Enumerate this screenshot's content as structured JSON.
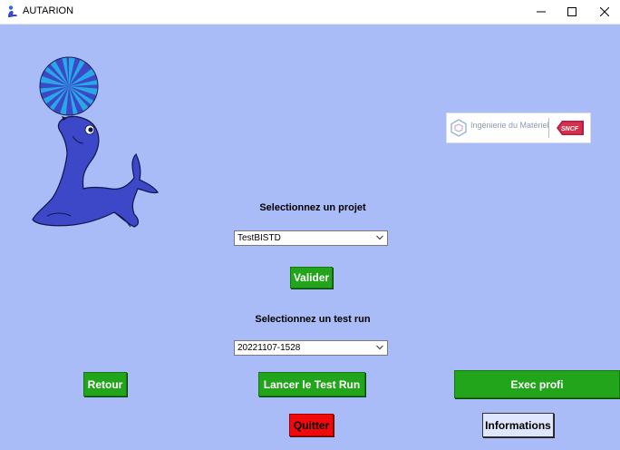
{
  "window": {
    "title": "AUTARION",
    "controls": {
      "minimize": "minimize-icon",
      "maximize": "maximize-icon",
      "close": "close-icon"
    }
  },
  "logo": {
    "text": "Ingénierie du Matériel",
    "brand": "SNCF"
  },
  "project": {
    "label": "Selectionnez un projet",
    "selected": "TestBISTD",
    "validate_label": "Valider"
  },
  "testrun": {
    "label": "Selectionnez un test run",
    "selected": "20221107-1528"
  },
  "actions": {
    "back_label": "Retour",
    "launch_label": "Lancer le Test Run",
    "exec_label": "Exec profi",
    "quit_label": "Quitter",
    "info_label": "Informations"
  },
  "colors": {
    "background": "#a9bcf7",
    "green_button": "#22a51a",
    "red_button": "#f20a0a",
    "info_button": "#dfe6ff",
    "seal": "#3c48c8",
    "ball_stripe": "#29a8e6"
  }
}
